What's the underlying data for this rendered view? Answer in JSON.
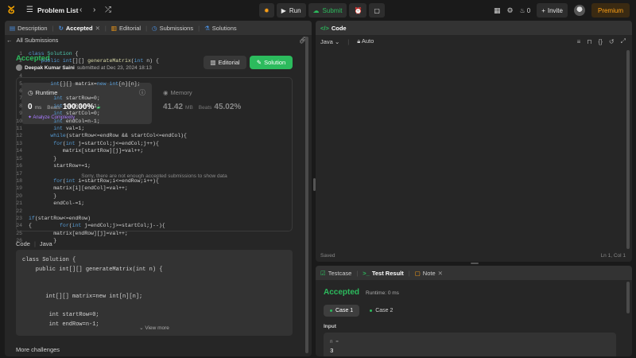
{
  "topbar": {
    "title": "Problem List",
    "run_label": "Run",
    "submit_label": "Submit",
    "invite_label": "Invite",
    "premium_label": "Premium",
    "streak_count": "0"
  },
  "left_tabs": {
    "description": "Description",
    "accepted": "Accepted",
    "editorial": "Editorial",
    "submissions": "Submissions",
    "solutions": "Solutions"
  },
  "submission": {
    "back_label": "All Submissions",
    "status": "Accepted",
    "author": "Deepak Kumar Saini",
    "submitted_text": "submitted at Dec 23, 2024 18:13",
    "editorial_button": "Editorial",
    "solution_button": "Solution",
    "runtime_label": "Runtime",
    "runtime_value": "0",
    "runtime_unit": "ms",
    "runtime_beats_label": "Beats",
    "runtime_beats": "100.00%",
    "analyze_label": "Analyze Complexity",
    "memory_label": "Memory",
    "memory_value": "41.42",
    "memory_unit": "MB",
    "memory_beats_label": "Beats",
    "memory_beats": "45.02%",
    "no_data_text": "Sorry, there are not enough accepted submissions to show data",
    "code_label": "Code",
    "code_lang": "Java",
    "view_more": "View more",
    "more_challenges": "More challenges"
  },
  "submission_code": [
    "class Solution {",
    "    public int[][] generateMatrix(int n) {",
    "",
    "",
    "       int[][] matrix=new int[n][n];",
    "",
    "        int startRow=0;",
    "        int endRow=n-1;"
  ],
  "editor": {
    "title": "Code",
    "language": "Java",
    "mode": "Auto",
    "status": "Saved",
    "cursor": "Ln 1, Col 1",
    "line_numbers": [
      "1",
      "2",
      "3",
      "4",
      "5",
      "6",
      "7",
      "8",
      "9",
      "10",
      "11",
      "12",
      "13",
      "14",
      "15",
      "16",
      "17",
      "18",
      "19",
      "20",
      "21",
      "22",
      "23",
      "24",
      "25",
      "26"
    ]
  },
  "test_panel": {
    "testcase_tab": "Testcase",
    "result_tab": "Test Result",
    "note_tab": "Note",
    "status": "Accepted",
    "runtime": "Runtime: 0 ms",
    "case1": "Case 1",
    "case2": "Case 2",
    "input_label": "Input",
    "input_var": "n =",
    "input_value": "3"
  }
}
